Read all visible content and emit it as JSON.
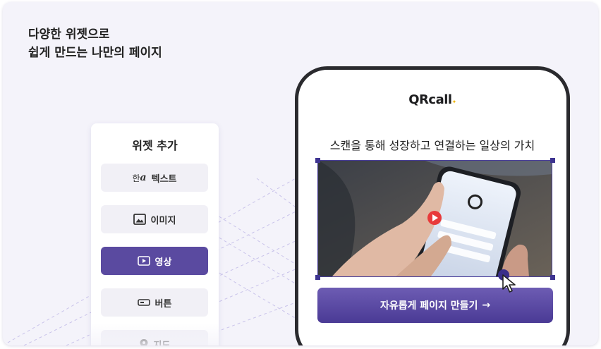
{
  "headline": {
    "line1": "다양한 위젯으로",
    "line2": "쉽게 만드는 나만의 페이지"
  },
  "panel": {
    "title": "위젯 추가",
    "items": [
      {
        "label": "텍스트",
        "icon": "text-hangul-icon",
        "icon_text": "한",
        "icon_text2": "a",
        "active": false
      },
      {
        "label": "이미지",
        "icon": "image-icon",
        "active": false
      },
      {
        "label": "영상",
        "icon": "video-play-icon",
        "active": true
      },
      {
        "label": "버튼",
        "icon": "button-icon",
        "active": false
      },
      {
        "label": "지도",
        "icon": "map-pin-icon",
        "active": false
      }
    ]
  },
  "phone": {
    "brand": "QRcall",
    "title": "스캔을 통해 성장하고 연결하는 일상의 가치",
    "cta_label": "자유롭게 페이지 만들기",
    "cta_arrow": "→"
  },
  "colors": {
    "background": "#f4f3fa",
    "accent": "#5a4aa0",
    "button_bg": "#f1f0f6",
    "play_red": "#e83a3a"
  }
}
